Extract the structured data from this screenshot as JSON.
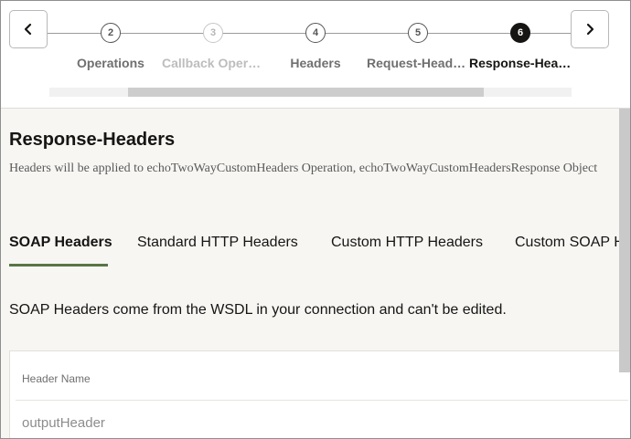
{
  "train": {
    "prev_label": "Previous",
    "next_label": "Next",
    "steps": [
      {
        "number": "2",
        "label": "Operations",
        "state": "visited"
      },
      {
        "number": "3",
        "label": "Callback Operation",
        "state": "disabled"
      },
      {
        "number": "4",
        "label": "Headers",
        "state": "visited"
      },
      {
        "number": "5",
        "label": "Request-Headers",
        "state": "visited"
      },
      {
        "number": "6",
        "label": "Response-Headers",
        "state": "active"
      }
    ]
  },
  "page": {
    "title": "Response-Headers",
    "subtitle": "Headers will be applied to echoTwoWayCustomHeaders Operation, echoTwoWayCustomHeadersResponse Object"
  },
  "tabs": [
    {
      "label": "SOAP Headers",
      "selected": true
    },
    {
      "label": "Standard HTTP Headers",
      "selected": false
    },
    {
      "label": "Custom HTTP Headers",
      "selected": false
    },
    {
      "label": "Custom SOAP Headers",
      "selected": false
    }
  ],
  "info_text": "SOAP Headers come from the WSDL in your connection and can't be edited.",
  "table": {
    "column_header": "Header Name",
    "rows": [
      "outputHeader"
    ]
  },
  "colors": {
    "accent": "#5b7446",
    "active_step": "#161513",
    "background": "#f7f6f3"
  }
}
